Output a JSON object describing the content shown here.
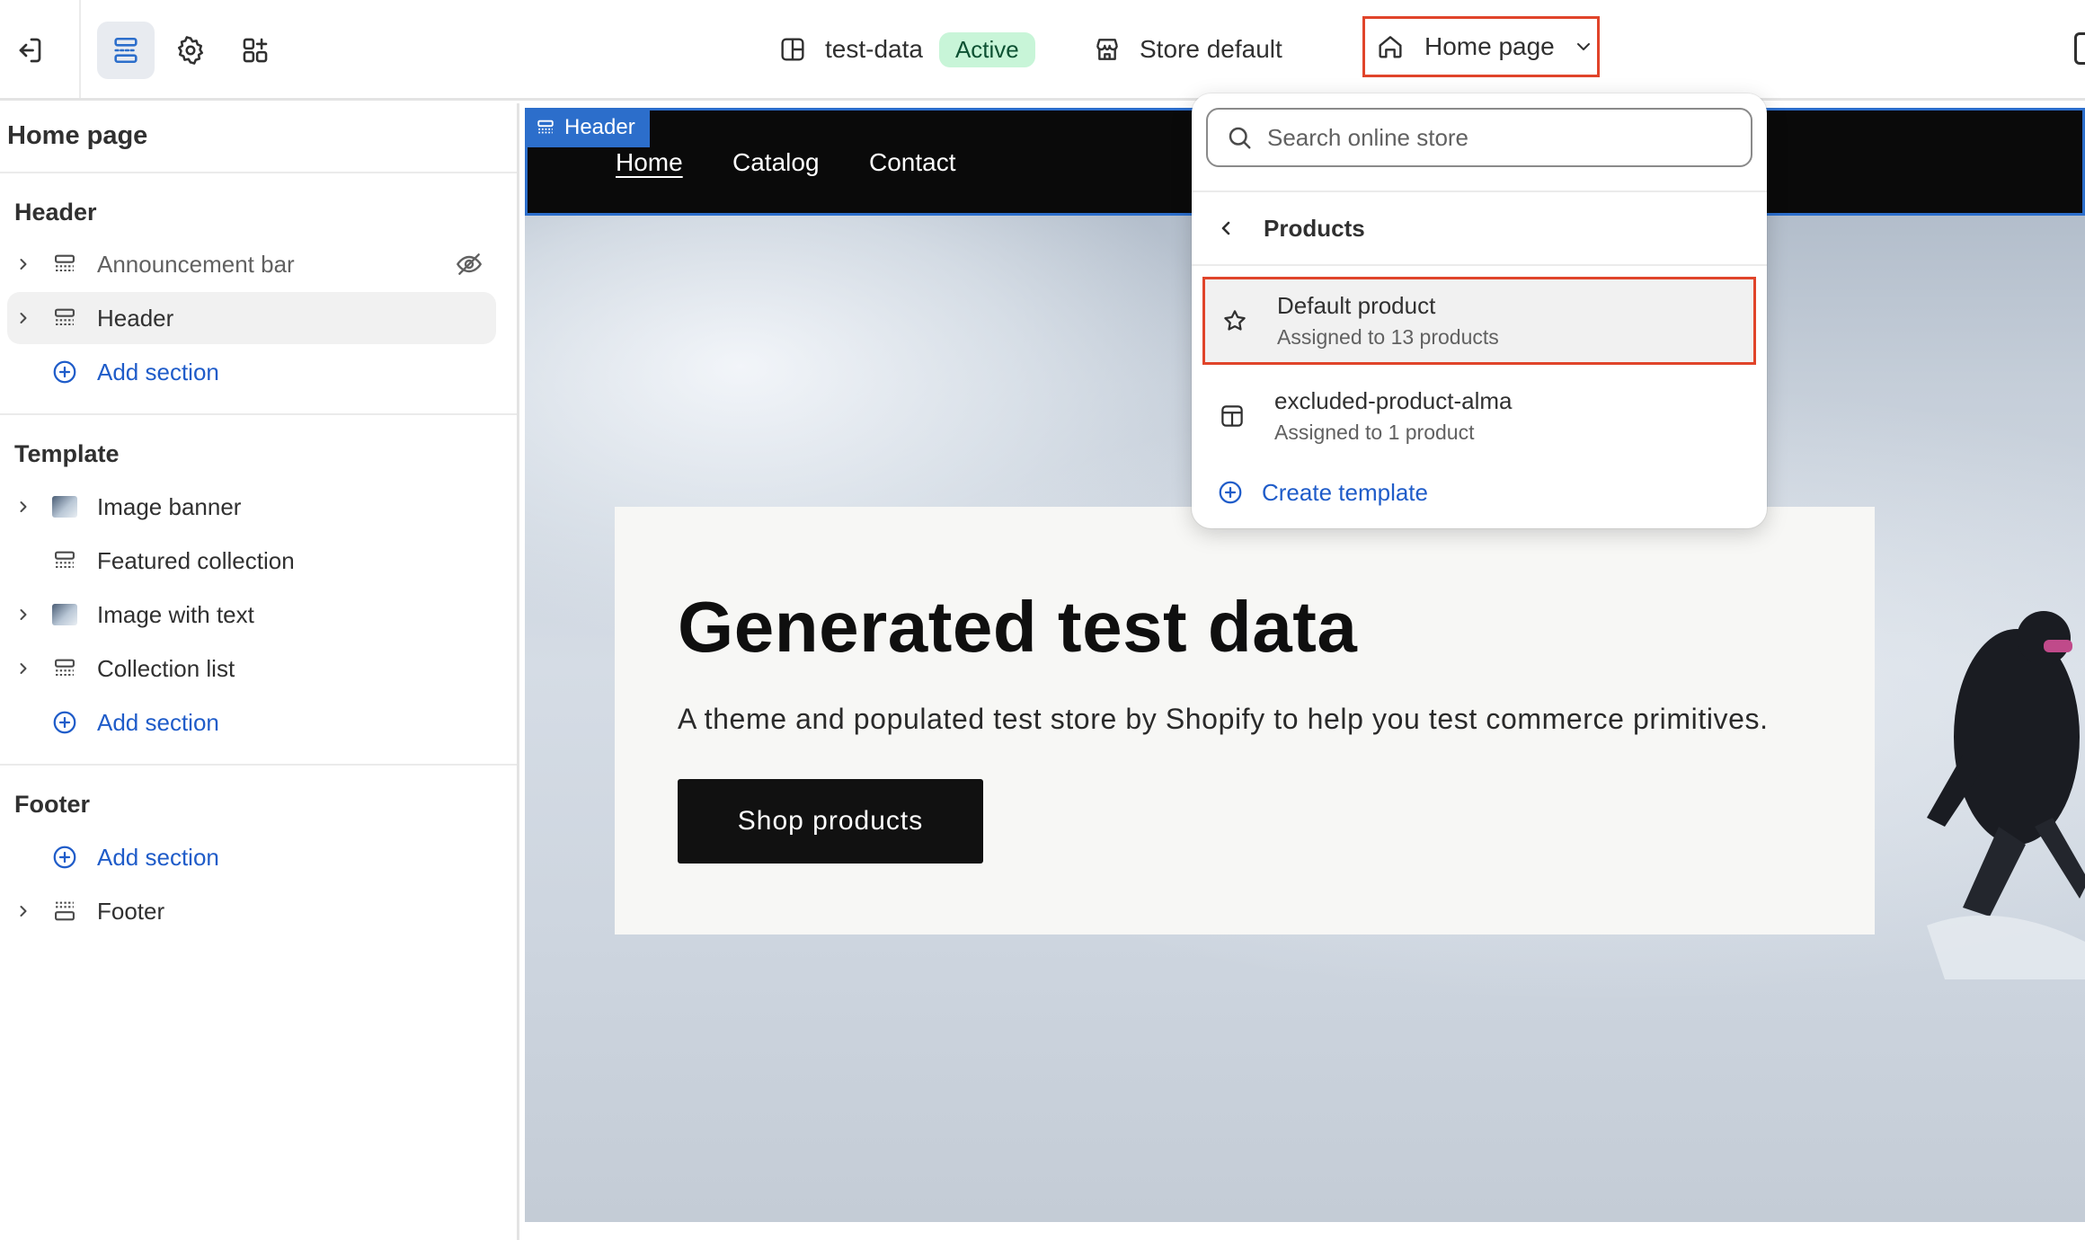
{
  "topbar": {
    "theme_name": "test-data",
    "theme_status": "Active",
    "store_context": "Store default",
    "page_selector": "Home page"
  },
  "sidebar": {
    "title": "Home page",
    "groups": [
      {
        "label": "Header",
        "items": [
          "Announcement bar",
          "Header"
        ],
        "add": "Add section"
      },
      {
        "label": "Template",
        "items": [
          "Image banner",
          "Featured collection",
          "Image with text",
          "Collection list"
        ],
        "add": "Add section"
      },
      {
        "label": "Footer",
        "items": [
          "Footer"
        ],
        "add": "Add section"
      }
    ]
  },
  "preview": {
    "section_tag": "Header",
    "nav": [
      "Home",
      "Catalog",
      "Contact"
    ],
    "hero_title": "Generated test data",
    "hero_subtitle": "A theme and populated test store by Shopify to help you test commerce primitives.",
    "hero_button": "Shop products"
  },
  "dropdown": {
    "search_placeholder": "Search online store",
    "back_label": "Products",
    "options": [
      {
        "title": "Default product",
        "subtitle": "Assigned to 13 products"
      },
      {
        "title": "excluded-product-alma",
        "subtitle": "Assigned to 1 product"
      }
    ],
    "create_label": "Create template"
  },
  "colors": {
    "accent": "#2c6ecb",
    "link": "#1f5cc9",
    "highlight_border": "#e0442a",
    "active_badge_bg": "#c8f5d8"
  }
}
